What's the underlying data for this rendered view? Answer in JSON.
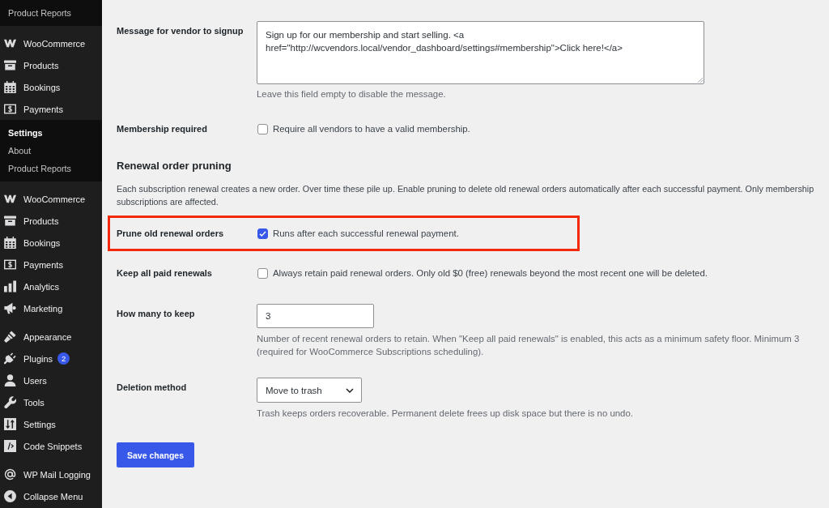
{
  "sidebar": {
    "blocks": [
      {
        "kind": "submenu",
        "items": [
          {
            "label": "Product Reports",
            "current": false
          }
        ]
      },
      {
        "kind": "menu",
        "items": [
          {
            "label": "WooCommerce"
          },
          {
            "label": "Products"
          },
          {
            "label": "Bookings"
          },
          {
            "label": "Payments"
          }
        ]
      },
      {
        "kind": "submenu",
        "items": [
          {
            "label": "Settings",
            "current": true
          },
          {
            "label": "About",
            "current": false
          },
          {
            "label": "Product Reports",
            "current": false
          }
        ]
      },
      {
        "kind": "menu",
        "items": [
          {
            "label": "WooCommerce"
          },
          {
            "label": "Products"
          },
          {
            "label": "Bookings"
          },
          {
            "label": "Payments"
          },
          {
            "label": "Analytics"
          },
          {
            "label": "Marketing"
          }
        ]
      },
      {
        "kind": "menu",
        "items": [
          {
            "label": "Appearance"
          },
          {
            "label": "Plugins",
            "badge": "2"
          },
          {
            "label": "Users"
          },
          {
            "label": "Tools"
          },
          {
            "label": "Settings"
          },
          {
            "label": "Code Snippets"
          }
        ]
      },
      {
        "kind": "menu",
        "items": [
          {
            "label": "WP Mail Logging"
          },
          {
            "label": "Collapse Menu"
          }
        ]
      }
    ]
  },
  "form": {
    "rows": [
      {
        "kind": "textarea",
        "label": "Message for vendor to signup",
        "value": "Sign up for our membership and start selling. <a href=\"http://wcvendors.local/vendor_dashboard/settings#membership\">Click here!</a>",
        "description": "Leave this field empty to disable the message.",
        "highlighted": false
      },
      {
        "kind": "checkbox",
        "label": "Membership required",
        "checked": false,
        "text": "Require all vendors to have a valid membership.",
        "highlighted": false
      }
    ],
    "section": {
      "heading": "Renewal order pruning",
      "intro": "Each subscription renewal creates a new order. Over time these pile up. Enable pruning to delete old renewal orders automatically after each successful payment. Only membership subscriptions are affected.",
      "rows": [
        {
          "kind": "checkbox",
          "label": "Prune old renewal orders",
          "checked": true,
          "text": "Runs after each successful renewal payment.",
          "highlighted": true
        },
        {
          "kind": "checkbox",
          "label": "Keep all paid renewals",
          "checked": false,
          "text": "Always retain paid renewal orders. Only old $0 (free) renewals beyond the most recent one will be deleted.",
          "highlighted": false
        },
        {
          "kind": "number",
          "label": "How many to keep",
          "value": "3",
          "description": "Number of recent renewal orders to retain. When \"Keep all paid renewals\" is enabled, this acts as a minimum safety floor. Minimum 3 (required for WooCommerce Subscriptions scheduling).",
          "highlighted": false
        },
        {
          "kind": "select",
          "label": "Deletion method",
          "value": "Move to trash",
          "description": "Trash keeps orders recoverable. Permanent delete frees up disk space but there is no undo.",
          "highlighted": false
        }
      ]
    },
    "save_button": {
      "label": "Save changes"
    }
  }
}
